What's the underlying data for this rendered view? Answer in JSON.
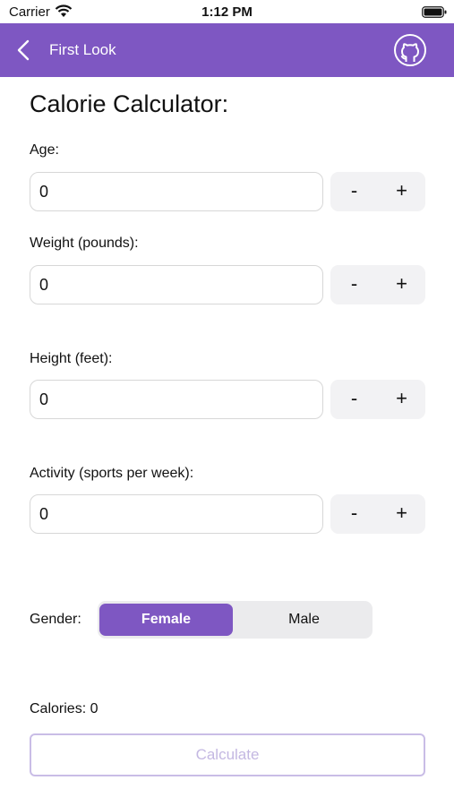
{
  "status_bar": {
    "carrier": "Carrier",
    "time": "1:12 PM"
  },
  "nav": {
    "title": "First Look",
    "back_icon": "chevron-left-icon",
    "action_icon": "github-icon"
  },
  "page": {
    "title": "Calorie Calculator:"
  },
  "fields": {
    "age": {
      "label": "Age:",
      "value": "0"
    },
    "weight": {
      "label": "Weight (pounds):",
      "value": "0"
    },
    "height": {
      "label": "Height (feet):",
      "value": "0"
    },
    "activity": {
      "label": "Activity (sports per week):",
      "value": "0"
    }
  },
  "stepper": {
    "minus": "-",
    "plus": "+"
  },
  "gender": {
    "label": "Gender:",
    "options": [
      "Female",
      "Male"
    ],
    "selected": "Female"
  },
  "result": {
    "calories_text": "Calories: 0"
  },
  "actions": {
    "calculate": "Calculate"
  },
  "colors": {
    "accent": "#7e57c2",
    "disabled_text": "#c4b8e2"
  }
}
